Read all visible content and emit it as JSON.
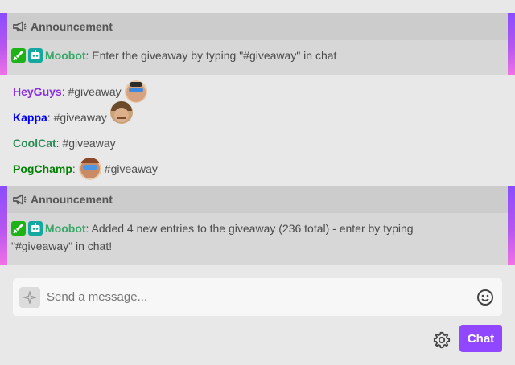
{
  "announcements": [
    {
      "header": "Announcement",
      "bot": "Moobot",
      "sep": ":",
      "text": " Enter the giveaway by typing \"#giveaway\" in chat"
    },
    {
      "header": "Announcement",
      "bot": "Moobot",
      "sep": ":",
      "text": " Added 4 new entries to the giveaway (236 total) - enter by typing \"#giveaway\" in chat!"
    }
  ],
  "messages": [
    {
      "user": "HeyGuys",
      "user_color": "#8a2be2",
      "text": ": #giveaway"
    },
    {
      "user": "Kappa",
      "user_color": "#0000ff",
      "text": ": #giveaway"
    },
    {
      "user": "CoolCat",
      "user_color": "#2e8b57",
      "text": ": #giveaway"
    },
    {
      "user": "PogChamp",
      "user_color": "#008000",
      "sep": ":",
      "text": " #giveaway"
    }
  ],
  "input": {
    "placeholder": "Send a message..."
  },
  "chat_button": "Chat",
  "icons": {
    "announcement": "megaphone-icon",
    "moderator": "sword-icon",
    "bot": "robot-icon",
    "input_left": "sparkle-icon",
    "emoji": "smiley-icon",
    "settings": "gear-icon"
  },
  "colors": {
    "accent": "#9147ff",
    "bot_name": "#3aa86a"
  }
}
